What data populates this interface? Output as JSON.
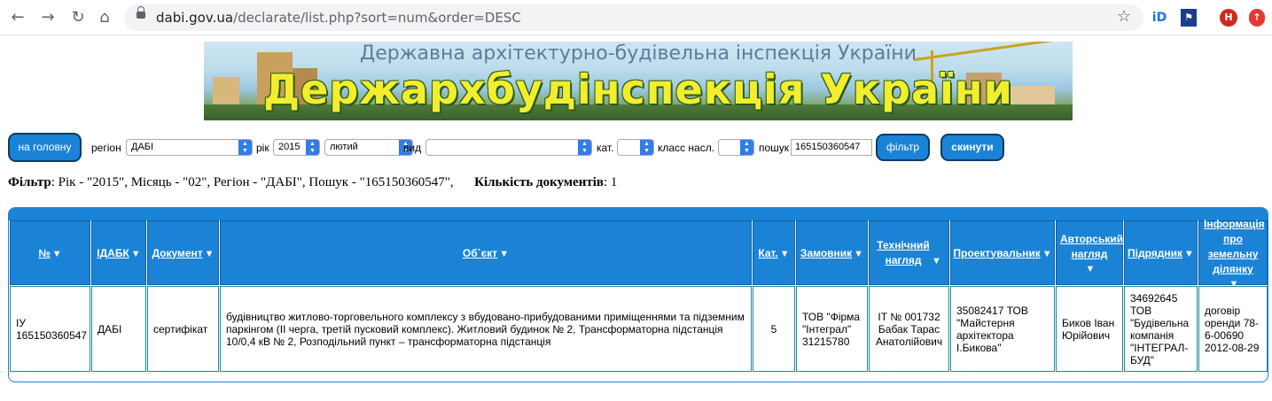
{
  "browser": {
    "url_host": "dabi.gov.ua",
    "url_path": "/declarate/list.php?sort=num&order=DESC"
  },
  "banner": {
    "subtitle": "Державна архітектурно-будівельна інспекція України",
    "title": "Держархбудінспекція України"
  },
  "filters": {
    "home_button": "на головну",
    "region_label": "регіон",
    "region_value": "ДАБІ",
    "year_label": "рік",
    "year_value": "2015",
    "month_value": "лютий",
    "type_label": "вид",
    "type_value": "",
    "category_label": "кат.",
    "category_value": "",
    "class_label": "класс насл.",
    "class_value": "",
    "search_label": "пошук",
    "search_value": "165150360547",
    "filter_button": "фільтр",
    "reset_button": "скинути"
  },
  "summary": {
    "filter_label": "Фільтр",
    "filter_text": ": Рік - \"2015\", Місяць - \"02\", Регіон - \"ДАБІ\", Пошук - \"165150360547\",",
    "count_label": "Кількість документів",
    "count_text": ": 1"
  },
  "table": {
    "headers": [
      "№",
      "ІДАБК",
      "Документ",
      "Об`єкт",
      "Кат.",
      "Замовник",
      "Технічний нагляд",
      "Проектувальник",
      "Авторський нагляд",
      "Підрядник",
      "Інформація про земельну ділянку"
    ],
    "rows": [
      [
        "ІУ 165150360547",
        "ДАБІ",
        "сертифікат",
        "будівництво житлово-торговельного комплексу з вбудовано-прибудованими приміщеннями та підземним паркінгом (ІІ черга, третій пусковий комплекс). Житловий будинок № 2, Трансформаторна підстанція 10/0,4 кВ № 2, Розподільний пункт – трансформаторна підстанція",
        "5",
        "ТОВ \"Фірма \"Інтеграл\" 31215780",
        "ІТ № 001732 Бабак Тарас Анатолійович",
        "35082417 ТОВ \"Майстерня архітектора І.Бикова\"",
        "Биков Іван Юрійович",
        "34692645 ТОВ \"Будівельна компанія \"ІНТЕГРАЛ-БУД\"",
        "договір оренди 78-6-00690 2012-08-29"
      ]
    ]
  },
  "colors": {
    "accent": "#1a83d6",
    "border_dark": "#0d3b66"
  }
}
